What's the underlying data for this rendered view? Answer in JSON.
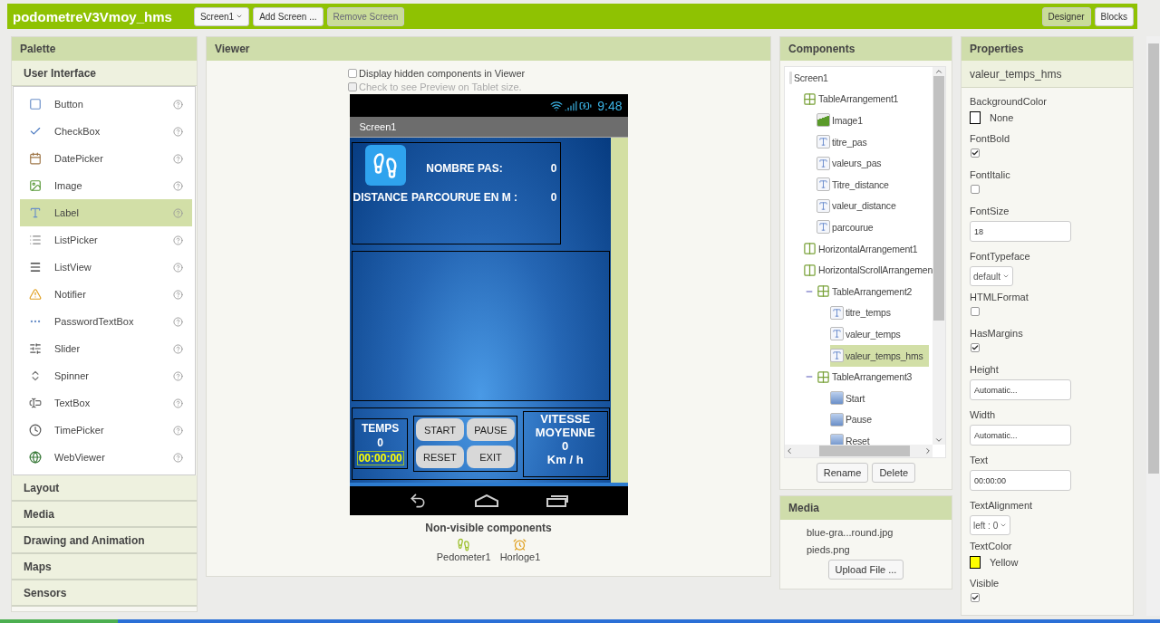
{
  "header": {
    "title": "podometreV3Vmoy_hms",
    "screen_dropdown": "Screen1",
    "buttons": [
      {
        "label": "Add Screen ...",
        "disabled": false
      },
      {
        "label": "Remove Screen",
        "disabled": true
      }
    ],
    "modes": [
      {
        "label": "Designer",
        "selected": true
      },
      {
        "label": "Blocks",
        "selected": false
      }
    ]
  },
  "palette": {
    "title": "Palette",
    "open_category": "User Interface",
    "items": [
      {
        "label": "Button",
        "selected": false
      },
      {
        "label": "CheckBox",
        "selected": false
      },
      {
        "label": "DatePicker",
        "selected": false
      },
      {
        "label": "Image",
        "selected": false
      },
      {
        "label": "Label",
        "selected": true
      },
      {
        "label": "ListPicker",
        "selected": false
      },
      {
        "label": "ListView",
        "selected": false
      },
      {
        "label": "Notifier",
        "selected": false
      },
      {
        "label": "PasswordTextBox",
        "selected": false
      },
      {
        "label": "Slider",
        "selected": false
      },
      {
        "label": "Spinner",
        "selected": false
      },
      {
        "label": "TextBox",
        "selected": false
      },
      {
        "label": "TimePicker",
        "selected": false
      },
      {
        "label": "WebViewer",
        "selected": false
      }
    ],
    "categories": [
      "Layout",
      "Media",
      "Drawing and Animation",
      "Maps",
      "Sensors"
    ]
  },
  "viewer": {
    "title": "Viewer",
    "options": [
      {
        "label": "Display hidden components in Viewer",
        "checked": false,
        "disabled": false
      },
      {
        "label": "Check to see Preview on Tablet size.",
        "checked": false,
        "disabled": true
      }
    ],
    "phone": {
      "time": "9:48",
      "screen_title": "Screen1",
      "steps_label": "NOMBRE PAS:",
      "steps_value": "0",
      "distance_label_1": "DISTANCE",
      "distance_label_2": "PARCOURUE EN M :",
      "distance_value": "0",
      "time_label": "TEMPS",
      "time_value": "0",
      "time_hms": "00:00:00",
      "buttons": [
        "START",
        "PAUSE",
        "RESET",
        "EXIT"
      ],
      "speed_label_1": "VITESSE",
      "speed_label_2": "MOYENNE",
      "speed_value": "0",
      "speed_unit": "Km / h"
    },
    "nonvisible_title": "Non-visible components",
    "nonvisible": [
      {
        "label": "Pedometer1",
        "kind": "pedometer"
      },
      {
        "label": "Horloge1",
        "kind": "clock"
      }
    ]
  },
  "components": {
    "title": "Components",
    "tree": [
      {
        "label": "Screen1",
        "kind": "screen",
        "selected": false,
        "children": [
          {
            "label": "TableArrangement1",
            "kind": "table",
            "selected": false,
            "children": [
              {
                "label": "Image1",
                "kind": "image",
                "selected": false
              },
              {
                "label": "titre_pas",
                "kind": "label",
                "selected": false
              },
              {
                "label": "valeurs_pas",
                "kind": "label",
                "selected": false
              },
              {
                "label": "Titre_distance",
                "kind": "label",
                "selected": false
              },
              {
                "label": "valeur_distance",
                "kind": "label",
                "selected": false
              },
              {
                "label": "parcourue",
                "kind": "label",
                "selected": false
              }
            ]
          },
          {
            "label": "HorizontalArrangement1",
            "kind": "horizontal",
            "selected": false
          },
          {
            "label": "HorizontalScrollArrangemen",
            "kind": "horizontal",
            "selected": false,
            "children": [
              {
                "label": "TableArrangement2",
                "kind": "table",
                "selected": false,
                "expanded": true,
                "children": [
                  {
                    "label": "titre_temps",
                    "kind": "label",
                    "selected": false
                  },
                  {
                    "label": "valeur_temps",
                    "kind": "label",
                    "selected": false
                  },
                  {
                    "label": "valeur_temps_hms",
                    "kind": "label",
                    "selected": true
                  }
                ]
              },
              {
                "label": "TableArrangement3",
                "kind": "table",
                "selected": false,
                "expanded": true,
                "children": [
                  {
                    "label": "Start",
                    "kind": "button",
                    "selected": false
                  },
                  {
                    "label": "Pause",
                    "kind": "button",
                    "selected": false
                  },
                  {
                    "label": "Reset",
                    "kind": "button",
                    "selected": false
                  }
                ]
              }
            ]
          }
        ]
      }
    ],
    "buttons": [
      "Rename",
      "Delete"
    ]
  },
  "media": {
    "title": "Media",
    "files": [
      "blue-gra...round.jpg",
      "pieds.png"
    ],
    "upload": "Upload File ..."
  },
  "properties": {
    "title": "Properties",
    "component": "valeur_temps_hms",
    "props": [
      {
        "label": "BackgroundColor",
        "kind": "color",
        "value": "None",
        "color": "#ffffff"
      },
      {
        "label": "FontBold",
        "kind": "checkbox",
        "checked": true
      },
      {
        "label": "FontItalic",
        "kind": "checkbox",
        "checked": false
      },
      {
        "label": "FontSize",
        "kind": "text",
        "value": "18"
      },
      {
        "label": "FontTypeface",
        "kind": "dropdown",
        "value": "default"
      },
      {
        "label": "HTMLFormat",
        "kind": "checkbox",
        "checked": false
      },
      {
        "label": "HasMargins",
        "kind": "checkbox",
        "checked": true
      },
      {
        "label": "Height",
        "kind": "text",
        "value": "Automatic..."
      },
      {
        "label": "Width",
        "kind": "text",
        "value": "Automatic..."
      },
      {
        "label": "Text",
        "kind": "text",
        "value": "00:00:00"
      },
      {
        "label": "TextAlignment",
        "kind": "dropdown",
        "value": "left : 0"
      },
      {
        "label": "TextColor",
        "kind": "color",
        "value": "Yellow",
        "color": "#ffff00"
      },
      {
        "label": "Visible",
        "kind": "checkbox",
        "checked": true
      }
    ]
  }
}
